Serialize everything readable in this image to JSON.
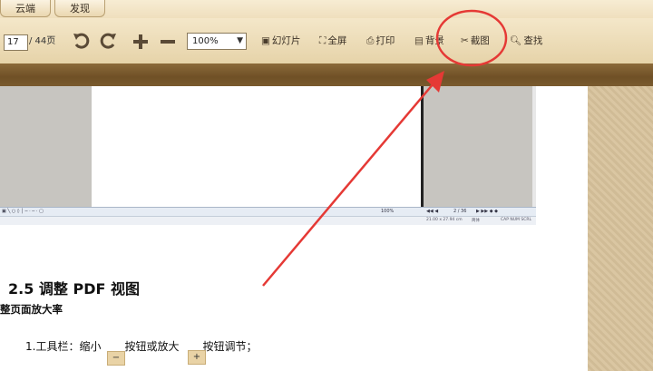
{
  "tabs": [
    {
      "label": "云端"
    },
    {
      "label": "发现"
    }
  ],
  "toolbar": {
    "current_page": "17",
    "page_total": "/ 44页",
    "zoom_value": "100%",
    "slideshow_label": "幻灯片",
    "fullscreen_label": "全屏",
    "print_label": "打印",
    "background_label": "背景",
    "screenshot_label": "截图",
    "search_label": "查找"
  },
  "embedded_status": {
    "zoom": "100%",
    "page": "2 / 36",
    "size": "21.00 x 27.94 cm",
    "mode": "简体",
    "keys": "CAP NUM SCRL"
  },
  "document": {
    "heading": "2.5 调整 PDF 视图",
    "subheading": "整页面放大率",
    "body_part1": "1.工具栏：缩小",
    "body_part2": "按钮或放大",
    "body_part3": "按钮调节；",
    "minus_glyph": "−",
    "plus_glyph": "+"
  },
  "annotation": {
    "color": "#e53935"
  }
}
